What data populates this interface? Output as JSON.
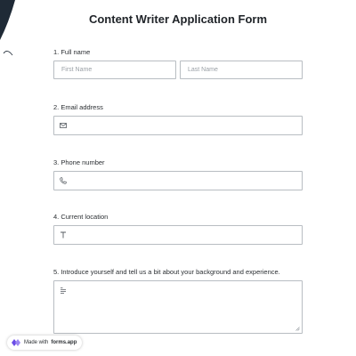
{
  "form": {
    "title": "Content Writer Application Form",
    "questions": [
      {
        "label": "1.  Full name",
        "first_placeholder": "First Name",
        "last_placeholder": "Last Name",
        "icon": ""
      },
      {
        "label": "2. Email address",
        "icon": "envelope-icon"
      },
      {
        "label": "3. Phone number",
        "icon": "phone-icon"
      },
      {
        "label": "4. Current location",
        "icon": "text-icon"
      },
      {
        "label": "5. Introduce yourself and tell us a bit about your background and experience.",
        "icon": "paragraph-icon"
      }
    ]
  },
  "footer": {
    "made_with": "Made with",
    "brand": "forms.app"
  },
  "colors": {
    "border": "#b8bdc2",
    "placeholder": "#9aa0a6",
    "brand_purple": "#6b4ce6"
  }
}
